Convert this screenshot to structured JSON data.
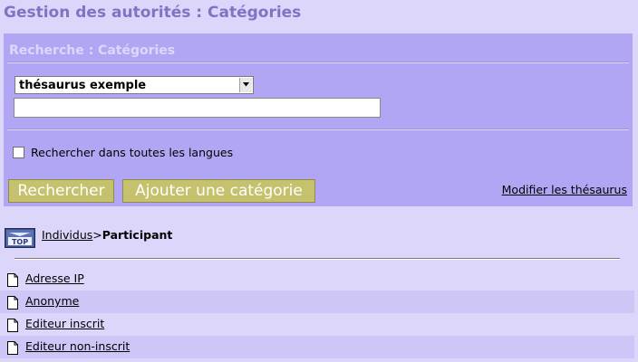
{
  "page": {
    "title": "Gestion des autorités : Catégories"
  },
  "search_panel": {
    "title": "Recherche : Catégories",
    "thesaurus_select": {
      "selected": "thésaurus exemple"
    },
    "search_input": {
      "value": "",
      "placeholder": ""
    },
    "all_languages_checkbox": {
      "label": "Rechercher dans toutes les langues",
      "checked": false
    },
    "search_button": "Rechercher",
    "add_category_button": "Ajouter une catégorie",
    "modify_thesaurus_link": "Modifier les thésaurus"
  },
  "top_icon": {
    "label": "TOP",
    "icon": "top-arrow-icon"
  },
  "breadcrumb": {
    "parent": "Individus",
    "separator": ">",
    "current": "Participant"
  },
  "categories": [
    {
      "label": "Adresse IP",
      "icon": "document-icon"
    },
    {
      "label": "Anonyme",
      "icon": "document-icon"
    },
    {
      "label": "Editeur inscrit",
      "icon": "document-icon"
    },
    {
      "label": "Editeur non-inscrit",
      "icon": "document-icon"
    }
  ],
  "colors": {
    "background": "#dcd6fb",
    "panel": "#b0a6f4",
    "title": "#7f74c4",
    "panel_title": "#dcd8fb",
    "button": "#c5c16c",
    "row_alt": "#cdc6f6"
  }
}
